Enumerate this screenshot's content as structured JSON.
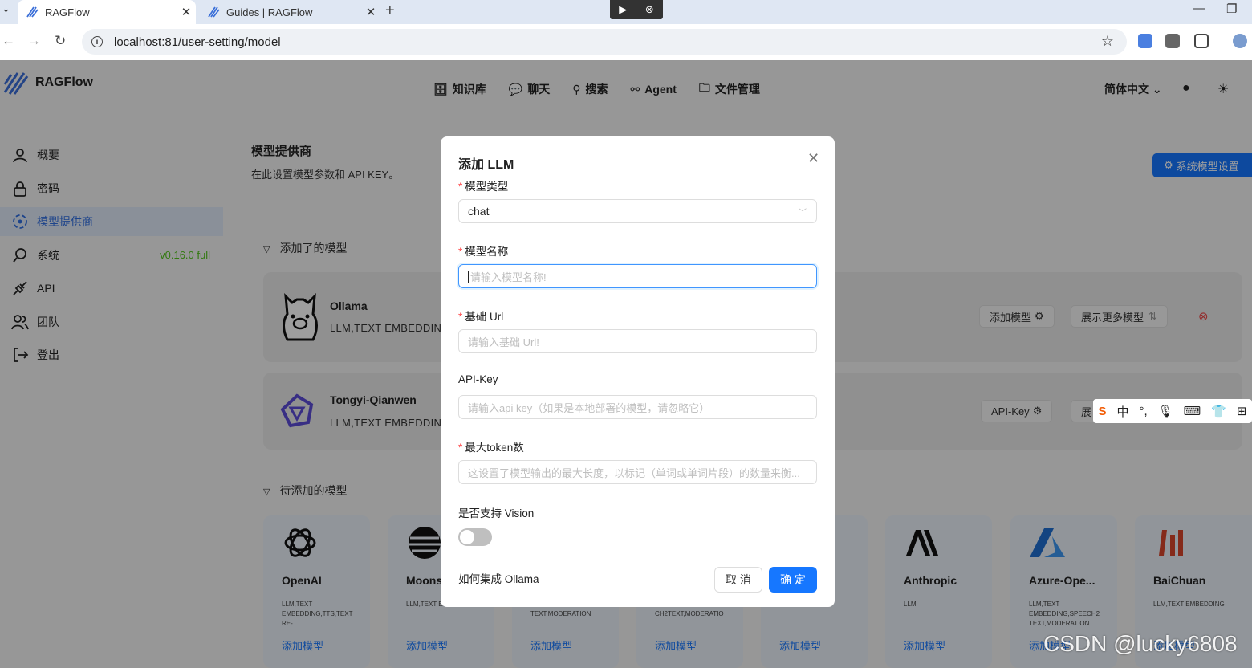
{
  "browser": {
    "tabs": [
      {
        "title": "RAGFlow",
        "active": true
      },
      {
        "title": "Guides | RAGFlow",
        "active": false
      }
    ],
    "url": "localhost:81/user-setting/model"
  },
  "app": {
    "name": "RAGFlow",
    "nav": [
      "知识库",
      "聊天",
      "搜索",
      "Agent",
      "文件管理"
    ],
    "language": "简体中文"
  },
  "sidebar": {
    "items": [
      {
        "label": "概要",
        "icon": "user-icon"
      },
      {
        "label": "密码",
        "icon": "lock-icon"
      },
      {
        "label": "模型提供商",
        "icon": "model-icon",
        "active": true
      },
      {
        "label": "系统",
        "icon": "search-icon",
        "badge": "v0.16.0 full"
      },
      {
        "label": "API",
        "icon": "api-icon"
      },
      {
        "label": "团队",
        "icon": "team-icon"
      },
      {
        "label": "登出",
        "icon": "logout-icon"
      }
    ]
  },
  "main": {
    "title": "模型提供商",
    "subtitle": "在此设置模型参数和 API KEY。",
    "system_button": "系统模型设置",
    "added_section": "添加了的模型",
    "pending_section": "待添加的模型",
    "added": [
      {
        "name": "Ollama",
        "tags": "LLM,TEXT EMBEDDIN",
        "btn1": "添加模型",
        "btn2": "展示更多模型"
      },
      {
        "name": "Tongyi-Qianwen",
        "tags": "LLM,TEXT EMBEDDIN",
        "btn1": "API-Key",
        "btn2": "展"
      }
    ],
    "providers": [
      {
        "name": "OpenAI",
        "tags": "LLM,TEXT EMBEDDING,TTS,TEXT RE-",
        "add": "添加模型"
      },
      {
        "name": "Moons",
        "tags": "LLM,TEXT E",
        "add": "添加模型"
      },
      {
        "name": "",
        "tags": "EMBEDDING,SPEECH2 TEXT,MODERATION",
        "add": "添加模型"
      },
      {
        "name": "",
        "tags": "EMBEDDING,TTS,SPEE CH2TEXT,MODERATIO",
        "add": "添加模型"
      },
      {
        "name": "",
        "tags": "",
        "add": "添加模型"
      },
      {
        "name": "Anthropic",
        "tags": "LLM",
        "add": "添加模型"
      },
      {
        "name": "Azure-Ope...",
        "tags": "LLM,TEXT EMBEDDING,SPEECH2 TEXT,MODERATION",
        "add": "添加模型"
      },
      {
        "name": "BaiChuan",
        "tags": "LLM,TEXT EMBEDDING",
        "add": "添加模型"
      }
    ]
  },
  "modal": {
    "title": "添加 LLM",
    "model_type_label": "模型类型",
    "model_type_value": "chat",
    "model_name_label": "模型名称",
    "model_name_placeholder": "请输入模型名称!",
    "base_url_label": "基础 Url",
    "base_url_placeholder": "请输入基础 Url!",
    "api_key_label": "API-Key",
    "api_key_placeholder": "请输入api key（如果是本地部署的模型，请忽略它）",
    "max_token_label": "最大token数",
    "max_token_placeholder": "这设置了模型输出的最大长度，以标记（单词或单词片段）的数量来衡...",
    "vision_label": "是否支持 Vision",
    "vision_enabled": false,
    "help_link": "如何集成 Ollama",
    "cancel": "取 消",
    "ok": "确 定"
  },
  "ime": {
    "mode": "中"
  },
  "watermark": "CSDN @lucky6808",
  "colors": {
    "primary": "#1677ff",
    "success": "#52c41a",
    "danger": "#ff4d4f"
  }
}
